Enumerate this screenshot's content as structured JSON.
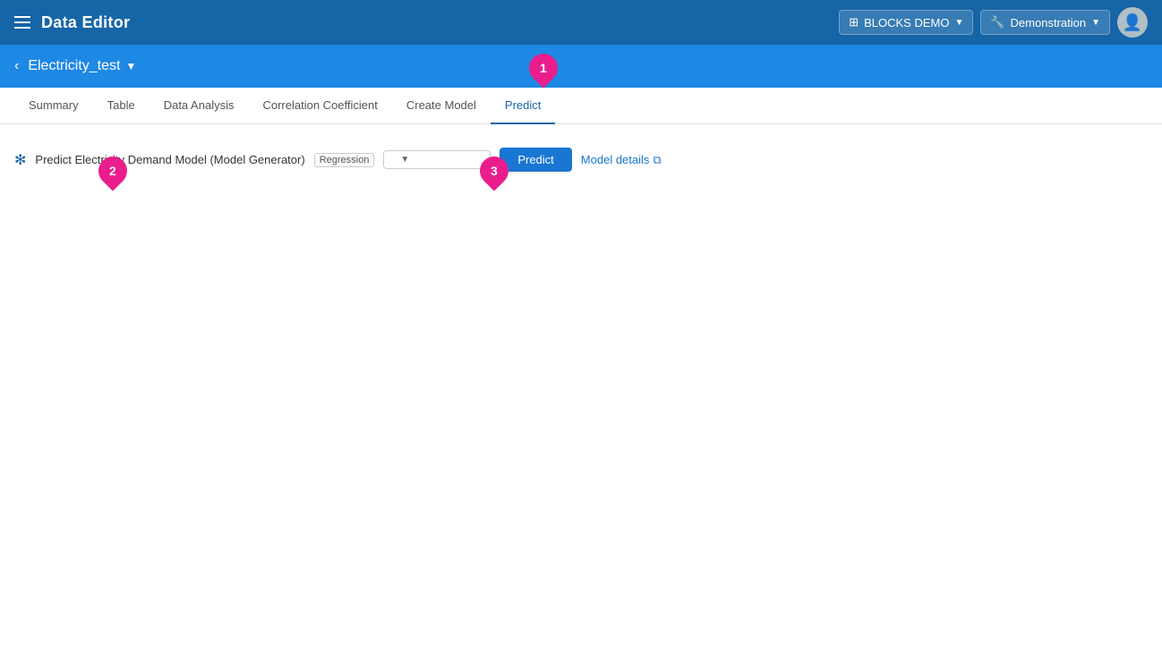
{
  "header": {
    "hamburger_label": "menu",
    "app_title": "Data Editor",
    "blocks_btn": "BLOCKS DEMO",
    "demo_btn": "Demonstration",
    "blocks_icon": "🗄",
    "wrench_icon": "🔧"
  },
  "sub_header": {
    "page_title": "Electricity_test",
    "back_icon": "‹"
  },
  "tabs": [
    {
      "id": "summary",
      "label": "Summary",
      "active": false
    },
    {
      "id": "table",
      "label": "Table",
      "active": false
    },
    {
      "id": "data-analysis",
      "label": "Data Analysis",
      "active": false
    },
    {
      "id": "correlation",
      "label": "Correlation Coefficient",
      "active": false
    },
    {
      "id": "create-model",
      "label": "Create Model",
      "active": false
    },
    {
      "id": "predict",
      "label": "Predict",
      "active": true
    }
  ],
  "predict_tab": {
    "model_icon": "✻",
    "model_label": "Predict Electricity Demand Model (Model Generator)",
    "model_type": "Regression",
    "dropdown_placeholder": "",
    "predict_btn": "Predict",
    "model_details_link": "Model details",
    "external_icon": "⧉"
  },
  "markers": [
    {
      "id": "1",
      "number": "1"
    },
    {
      "id": "2",
      "number": "2"
    },
    {
      "id": "3",
      "number": "3"
    }
  ]
}
